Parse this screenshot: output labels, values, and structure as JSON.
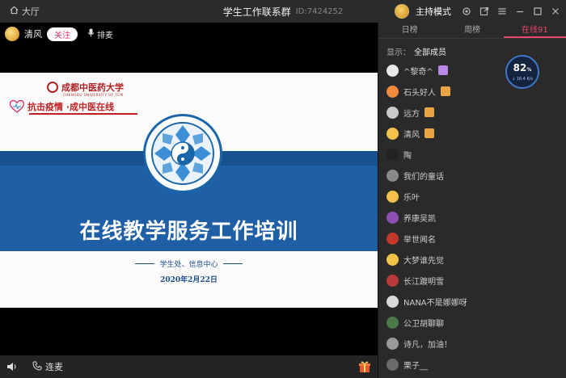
{
  "titlebar": {
    "home_label": "大厅",
    "title": "学生工作联系群",
    "room_id": "ID:7424252",
    "host_mode": "主持模式"
  },
  "stage": {
    "speaker_name": "清风",
    "follow_label": "关注",
    "mic_queue_label": "排麦"
  },
  "slide": {
    "uni_name": "成都中医药大学",
    "uni_en": "CHENGDU UNIVERSITY OF TCM",
    "campaign": "抗击疫情 ·成中医在线",
    "title": "在线教学服务工作培训",
    "department": "学生处、信息中心",
    "date": "2020年2月22日"
  },
  "bottombar": {
    "connect_label": "连麦"
  },
  "panel": {
    "tabs": [
      "日榜",
      "周榜",
      "在线91"
    ],
    "active_tab": 2,
    "filter_label": "显示：",
    "filter_value": "全部成员",
    "members": [
      {
        "name": "^黎奇^",
        "avatar_color": "#e8e8e8",
        "badge_color": "#b987e8"
      },
      {
        "name": "石头好人",
        "avatar_color": "#f08a3c",
        "badge_color": "#e9a444"
      },
      {
        "name": "远方",
        "avatar_color": "#c9c9c9",
        "badge_color": "#e9a444"
      },
      {
        "name": "清风",
        "avatar_color": "#f2c14a",
        "badge_color": "#e9a444"
      },
      {
        "name": "陶",
        "avatar_color": "#222222",
        "badge_color": ""
      },
      {
        "name": "我们的童话",
        "avatar_color": "#8a8a8a",
        "badge_color": ""
      },
      {
        "name": "乐叶",
        "avatar_color": "#f2c14a",
        "badge_color": ""
      },
      {
        "name": "养康吴凯",
        "avatar_color": "#8e4fb3",
        "badge_color": ""
      },
      {
        "name": "举世闻名",
        "avatar_color": "#c0392b",
        "badge_color": ""
      },
      {
        "name": "大梦谁先觉",
        "avatar_color": "#f2c14a",
        "badge_color": ""
      },
      {
        "name": "长江踱明雪",
        "avatar_color": "#b83b3b",
        "badge_color": ""
      },
      {
        "name": "NANA不是娜娜呀",
        "avatar_color": "#d8d8d8",
        "badge_color": ""
      },
      {
        "name": "公卫胡聊聊",
        "avatar_color": "#4a7a4a",
        "badge_color": ""
      },
      {
        "name": "诗凡，加油！",
        "avatar_color": "#9a9a9a",
        "badge_color": ""
      },
      {
        "name": "栗子__",
        "avatar_color": "#6b6b6b",
        "badge_color": ""
      }
    ],
    "gauge": {
      "percent": "82",
      "percent_unit": "%",
      "speed": "↓ 16.4 K/s"
    }
  }
}
